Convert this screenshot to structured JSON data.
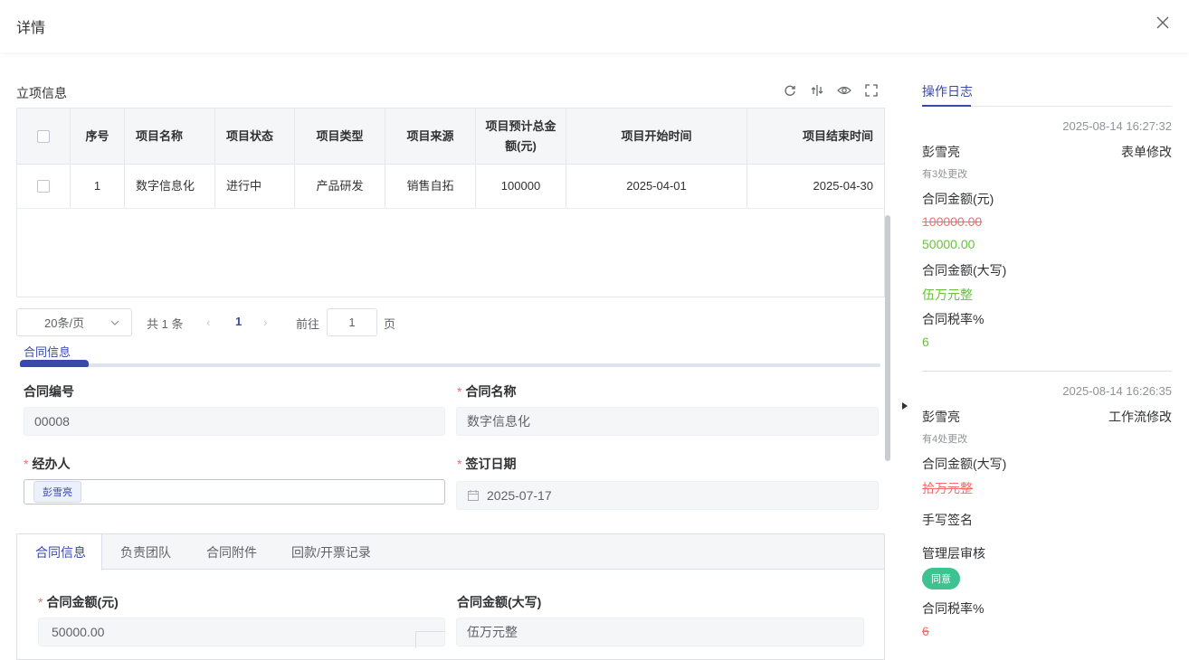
{
  "header": {
    "title": "详情"
  },
  "project": {
    "section_title": "立项信息",
    "columns": [
      "序号",
      "项目名称",
      "项目状态",
      "项目类型",
      "项目来源",
      "项目预计总金额(元)",
      "项目开始时间",
      "项目结束时间"
    ],
    "rows": [
      {
        "index": "1",
        "name": "数字信息化",
        "status": "进行中",
        "type": "产品研发",
        "source": "销售自拓",
        "amount": "100000",
        "start": "2025-04-01",
        "end": "2025-04-30"
      }
    ]
  },
  "pagination": {
    "page_size": "20条/页",
    "total": "共 1 条",
    "current": "1",
    "goto_label": "前往",
    "goto_value": "1",
    "page_unit": "页"
  },
  "contract_tab": {
    "label": "合同信息"
  },
  "form": {
    "contract_no": {
      "label": "合同编号",
      "value": "00008"
    },
    "contract_name": {
      "label": "合同名称",
      "value": "数字信息化"
    },
    "handler": {
      "label": "经办人",
      "tag": "彭雪亮"
    },
    "sign_date": {
      "label": "签订日期",
      "value": "2025-07-17"
    },
    "amount": {
      "label": "合同金额(元)",
      "value": "50000.00"
    },
    "amount_upper": {
      "label": "合同金额(大写)",
      "value": "伍万元整"
    }
  },
  "tabs": [
    "合同信息",
    "负责团队",
    "合同附件",
    "回款/开票记录"
  ],
  "log": {
    "tab": "操作日志",
    "entries": [
      {
        "time": "2025-08-14 16:27:32",
        "user": "彭雪亮",
        "action": "表单修改",
        "count": "有3处更改",
        "f1": "合同金额(元)",
        "f1_old": "100000.00",
        "f1_new": "50000.00",
        "f2": "合同金额(大写)",
        "f2_new": "伍万元整",
        "f3": "合同税率%",
        "f3_new": "6"
      },
      {
        "time": "2025-08-14 16:26:35",
        "user": "彭雪亮",
        "action": "工作流修改",
        "count": "有4处更改",
        "f1": "合同金额(大写)",
        "f1_old": "拾万元整",
        "f2": "手写签名",
        "f3": "管理层审核",
        "f3_badge": "同意",
        "f4": "合同税率%",
        "f4_old": "6"
      }
    ]
  }
}
